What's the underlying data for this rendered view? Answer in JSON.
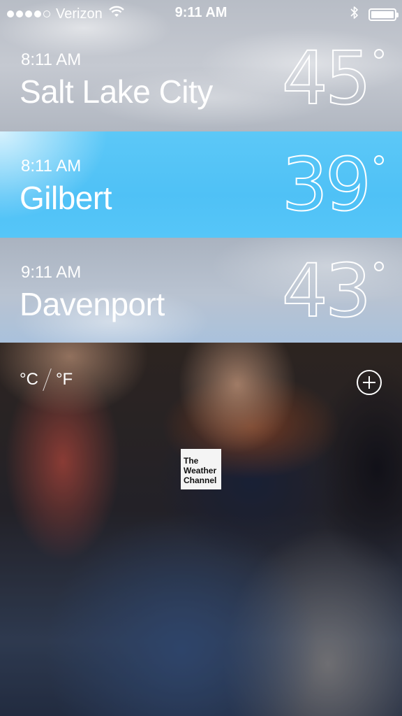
{
  "status_bar": {
    "carrier": "Verizon",
    "time": "9:11 AM",
    "signal_bars_filled": 4,
    "signal_bars_total": 5
  },
  "cities": [
    {
      "local_time": "8:11 AM",
      "name": "Salt Lake City",
      "temp": "45",
      "style": "cloudy"
    },
    {
      "local_time": "8:11 AM",
      "name": "Gilbert",
      "temp": "39",
      "style": "sunny"
    },
    {
      "local_time": "9:11 AM",
      "name": "Davenport",
      "temp": "43",
      "style": "cloudy"
    }
  ],
  "controls": {
    "celsius_label": "°C",
    "fahrenheit_label": "°F"
  },
  "logo": {
    "line1": "The",
    "line2": "Weather",
    "line3": "Channel"
  },
  "colors": {
    "sunny_row": "#4fc1f6",
    "cloudy_row": "#b8bdc6",
    "text": "#ffffff"
  }
}
